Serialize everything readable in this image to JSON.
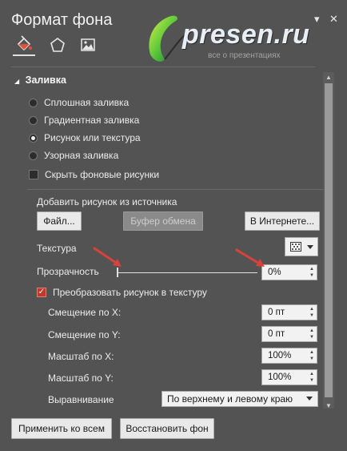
{
  "pane": {
    "title": "Формат фона",
    "dropdown_glyph": "▾",
    "close_glyph": "✕"
  },
  "tabs": [
    {
      "icon": "paint-bucket-icon",
      "active": true
    },
    {
      "icon": "pentagon-icon",
      "active": false
    },
    {
      "icon": "picture-icon",
      "active": false
    }
  ],
  "watermark": {
    "text": "presen.ru",
    "subtext": "все о презентациях"
  },
  "section": {
    "label": "Заливка",
    "collapse_glyph": "◢"
  },
  "fill_options": [
    {
      "label": "Сплошная заливка",
      "selected": false
    },
    {
      "label": "Градиентная заливка",
      "selected": false
    },
    {
      "label": "Рисунок или текстура",
      "selected": true
    },
    {
      "label": "Узорная заливка",
      "selected": false
    }
  ],
  "hide_background": {
    "label": "Скрыть фоновые рисунки",
    "checked": false
  },
  "insert_from": {
    "label": "Добавить рисунок из источника",
    "file_button": "Файл...",
    "clipboard_button": "Буфер обмена",
    "online_button": "В Интернете..."
  },
  "texture": {
    "label": "Текстура"
  },
  "transparency": {
    "label": "Прозрачность",
    "value": "0%",
    "fraction": 0
  },
  "tile": {
    "label": "Преобразовать рисунок в текстуру",
    "checked": true
  },
  "offsets": [
    {
      "label": "Смещение по X:",
      "value": "0 пт"
    },
    {
      "label": "Смещение по Y:",
      "value": "0 пт"
    },
    {
      "label": "Масштаб по X:",
      "value": "100%"
    },
    {
      "label": "Масштаб по Y:",
      "value": "100%"
    }
  ],
  "alignment": {
    "label": "Выравнивание",
    "value": "По верхнему и левому краю"
  },
  "footer": {
    "apply_all": "Применить ко всем",
    "reset": "Восстановить фон"
  },
  "colors": {
    "background": "#535353",
    "arrow_annotation": "#d9423a",
    "checkbox_checked": "#c0392b"
  }
}
